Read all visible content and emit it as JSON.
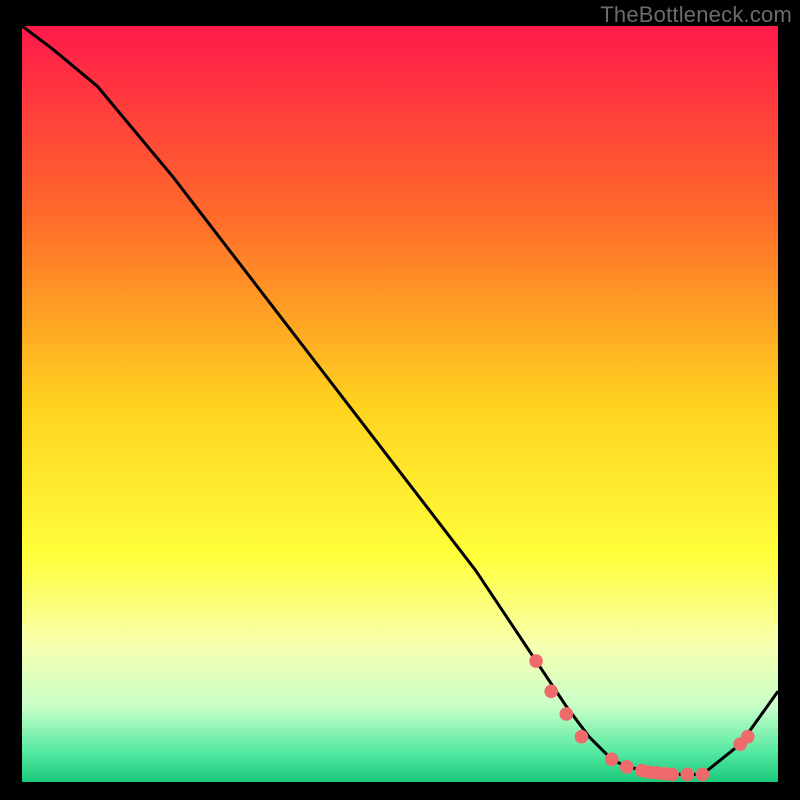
{
  "watermark": "TheBottleneck.com",
  "chart_data": {
    "type": "line",
    "title": "",
    "xlabel": "",
    "ylabel": "",
    "xlim": [
      0,
      100
    ],
    "ylim": [
      0,
      100
    ],
    "background_gradient": {
      "stops": [
        {
          "offset": 0.0,
          "color": "#ff1a4b"
        },
        {
          "offset": 0.25,
          "color": "#ff6a2a"
        },
        {
          "offset": 0.5,
          "color": "#ffd21f"
        },
        {
          "offset": 0.7,
          "color": "#ffff3a"
        },
        {
          "offset": 0.82,
          "color": "#f7ffb0"
        },
        {
          "offset": 0.9,
          "color": "#c8ffc8"
        },
        {
          "offset": 0.96,
          "color": "#56e9a2"
        },
        {
          "offset": 1.0,
          "color": "#19c97a"
        }
      ]
    },
    "series": [
      {
        "name": "curve",
        "type": "line",
        "color": "#000000",
        "x": [
          0,
          4,
          10,
          20,
          30,
          40,
          50,
          60,
          68,
          72,
          75,
          78,
          80,
          85,
          90,
          95,
          100
        ],
        "y": [
          100,
          97,
          92,
          80,
          67,
          54,
          41,
          28,
          16,
          10,
          6,
          3,
          2,
          1,
          1,
          5,
          12
        ]
      },
      {
        "name": "markers",
        "type": "scatter",
        "color": "#ef6a6a",
        "x": [
          68,
          70,
          72,
          74,
          78,
          80,
          82,
          83,
          84,
          85,
          86,
          88,
          90,
          95,
          96
        ],
        "y": [
          16,
          12,
          9,
          6,
          3,
          2,
          1.5,
          1.3,
          1.2,
          1.1,
          1.0,
          1.0,
          1.0,
          5,
          6
        ]
      }
    ]
  }
}
